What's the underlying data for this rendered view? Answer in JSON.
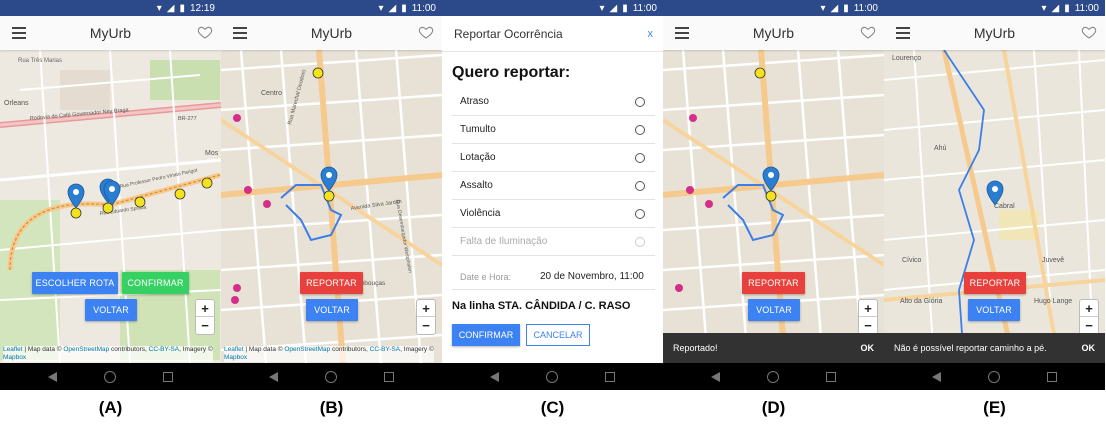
{
  "screens": [
    {
      "id": "A",
      "time": "12:19",
      "app_title": "MyUrb",
      "buttons": {
        "choose_route": "ESCOLHER ROTA",
        "confirm": "CONFIRMAR",
        "back": "VOLTAR"
      },
      "map_labels": [
        "Rua Três Marias",
        "Orleans",
        "Rodovia do Café Governador Ney Braga",
        "BR-277",
        "Rua Professor Pedro Viriato Parigot",
        "Rua Eduardo Sprada",
        "Mos"
      ]
    },
    {
      "id": "B",
      "time": "11:00",
      "app_title": "MyUrb",
      "buttons": {
        "report": "REPORTAR",
        "back": "VOLTAR"
      },
      "map_labels": [
        "Centro",
        "Rua Marechal Deodoro",
        "Avenida Silva Jardim",
        "Rua Desembargador Westphalen",
        "Rebouças"
      ]
    },
    {
      "id": "C",
      "time": "11:00",
      "dialog": {
        "title": "Reportar Ocorrência",
        "close": "x",
        "subtitle": "Quero reportar:",
        "options": [
          {
            "label": "Atraso",
            "disabled": false
          },
          {
            "label": "Tumulto",
            "disabled": false
          },
          {
            "label": "Lotação",
            "disabled": false
          },
          {
            "label": "Assalto",
            "disabled": false
          },
          {
            "label": "Violência",
            "disabled": false
          },
          {
            "label": "Falta de Iluminação",
            "disabled": true
          }
        ],
        "datetime_label": "Date e Hora:",
        "datetime_value": "20 de Novembro, 11:00",
        "line_text": "Na linha STA. CÂNDIDA / C. RASO",
        "confirm": "CONFIRMAR",
        "cancel": "CANCELAR"
      }
    },
    {
      "id": "D",
      "time": "11:00",
      "app_title": "MyUrb",
      "buttons": {
        "report": "REPORTAR",
        "back": "VOLTAR"
      },
      "snackbar": {
        "message": "Reportado!",
        "action": "OK"
      }
    },
    {
      "id": "E",
      "time": "11:00",
      "app_title": "MyUrb",
      "buttons": {
        "report": "REPORTAR",
        "back": "VOLTAR"
      },
      "map_labels": [
        "Lourenço",
        "Ahú",
        "Cabral",
        "Cívico",
        "Alto da Glória",
        "Juvevê",
        "Hugo Lange"
      ],
      "snackbar": {
        "message": "Não é possível reportar caminho a pé.",
        "action": "OK"
      }
    }
  ],
  "attribution": {
    "leaflet": "Leaflet",
    "sep": " | Map data © ",
    "osm": "OpenStreetMap",
    "contrib": " contributors, ",
    "cc": "CC-BY-SA",
    "imagery": ", Imagery © ",
    "mapbox": "Mapbox"
  },
  "zoom": {
    "in": "+",
    "out": "−"
  },
  "captions": [
    "(A)",
    "(B)",
    "(C)",
    "(D)",
    "(E)"
  ],
  "colors": {
    "statusbar": "#2c4a8a",
    "button_blue": "#3d82f2",
    "button_green": "#37d163",
    "button_red": "#e8403c",
    "route": "#3d7ee8",
    "stop_yellow": "#f4e21c",
    "marker_blue": "#2a7dd1"
  }
}
